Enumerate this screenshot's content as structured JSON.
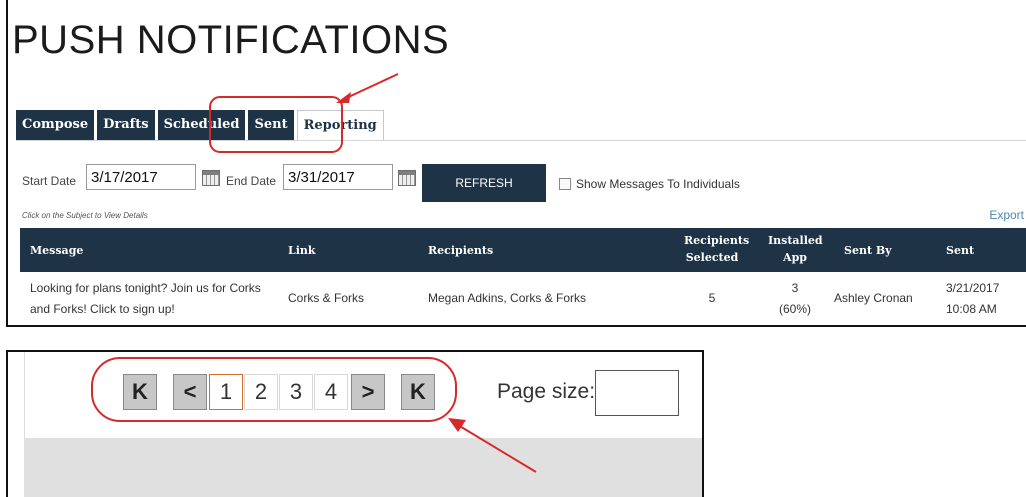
{
  "page_title": "PUSH NOTIFICATIONS",
  "tabs": [
    {
      "label": "Compose"
    },
    {
      "label": "Drafts"
    },
    {
      "label": "Scheduled"
    },
    {
      "label": "Sent"
    },
    {
      "label": "Reporting",
      "active": true
    }
  ],
  "filters": {
    "start_label": "Start Date",
    "start_value": "3/17/2017",
    "end_label": "End Date",
    "end_value": "3/31/2017",
    "refresh_label": "REFRESH",
    "show_individuals_label": "Show Messages To Individuals"
  },
  "hint": "Click on the Subject to View Details",
  "export_label": "Export",
  "table": {
    "headers": {
      "message": "Message",
      "link": "Link",
      "recipients": "Recipients",
      "recipients_selected_1": "Recipients",
      "recipients_selected_2": "Selected",
      "installed_1": "Installed",
      "installed_2": "App",
      "sent_by": "Sent By",
      "sent": "Sent"
    },
    "rows": [
      {
        "message_1": "Looking for plans tonight? Join us for Corks",
        "message_2": "and Forks! Click to sign up!",
        "link": "Corks & Forks",
        "recipients": "Megan Adkins, Corks & Forks",
        "recipients_selected": "5",
        "installed_count": "3",
        "installed_pct": "(60%)",
        "sent_by": "Ashley Cronan",
        "sent_date": "3/21/2017",
        "sent_time": "10:08 AM"
      }
    ]
  },
  "pager": {
    "first_icon": "K",
    "prev_icon": "<",
    "pages": [
      "1",
      "2",
      "3",
      "4"
    ],
    "current_page": "1",
    "next_icon": ">",
    "last_icon": "K",
    "page_size_label": "Page size:"
  },
  "colors": {
    "navy": "#1f3347",
    "annotation_red": "#d8282a",
    "link_blue": "#4e88ad",
    "current_page_border": "#d0702e"
  }
}
